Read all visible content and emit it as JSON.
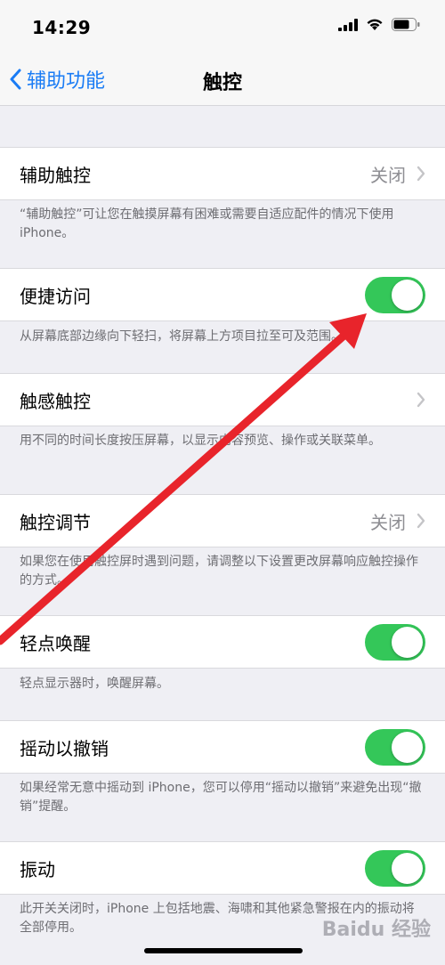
{
  "status": {
    "time": "14:29"
  },
  "nav": {
    "back_label": "辅助功能",
    "title": "触控"
  },
  "sections": [
    {
      "label": "辅助触控",
      "value": "关闭",
      "chevron": true,
      "footer": "“辅助触控”可让您在触摸屏幕有困难或需要自适应配件的情况下使用 iPhone。"
    },
    {
      "label": "便捷访问",
      "toggle": true,
      "footer": "从屏幕底部边缘向下轻扫，将屏幕上方项目拉至可及范围。"
    },
    {
      "label": "触感触控",
      "chevron": true,
      "footer": "用不同的时间长度按压屏幕，以显示内容预览、操作或关联菜单。"
    },
    {
      "label": "触控调节",
      "value": "关闭",
      "chevron": true,
      "footer": "如果您在使用触控屏时遇到问题，请调整以下设置更改屏幕响应触控操作的方式。"
    },
    {
      "label": "轻点唤醒",
      "toggle": true,
      "footer": "轻点显示器时，唤醒屏幕。"
    },
    {
      "label": "摇动以撤销",
      "toggle": true,
      "footer": "如果经常无意中摇动到 iPhone，您可以停用“摇动以撤销”来避免出现“撤销”提醒。"
    },
    {
      "label": "振动",
      "toggle": true,
      "footer": "此开关关闭时，iPhone 上包括地震、海啸和其他紧急警报在内的振动将全部停用。"
    }
  ],
  "colors": {
    "accent": "#1a7cf5",
    "toggle_on": "#34c759",
    "annotation_arrow": "#e8242b"
  },
  "watermark": "Baidu 经验"
}
